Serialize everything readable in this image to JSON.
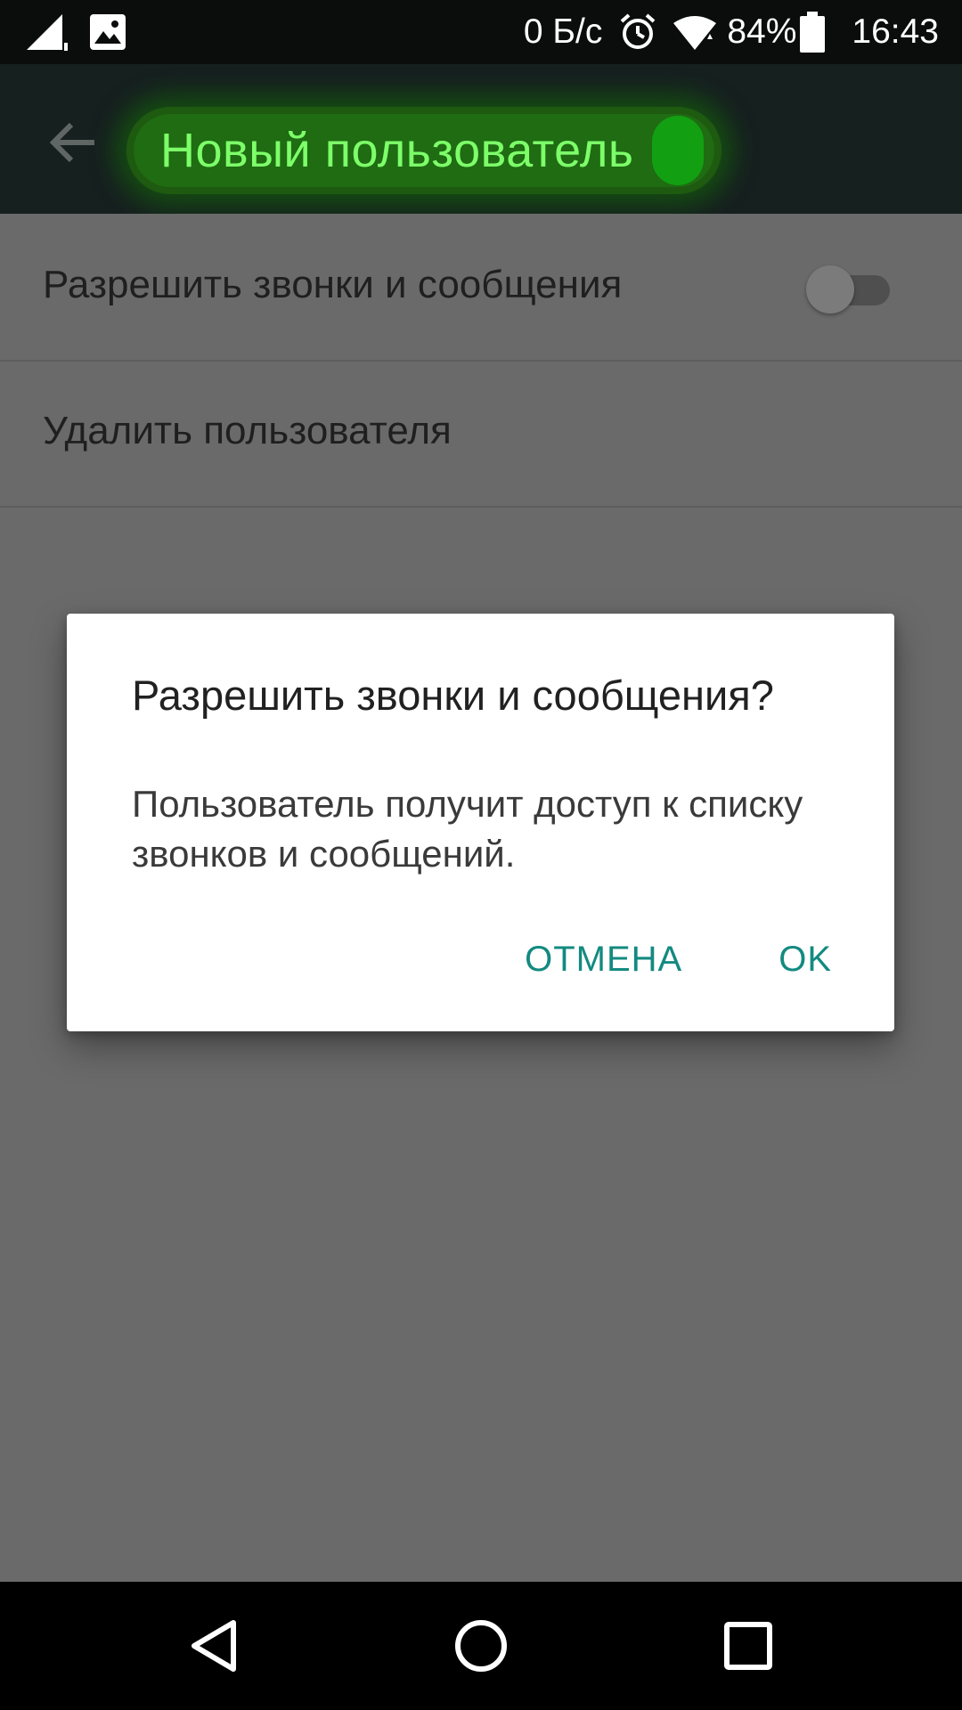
{
  "status_bar": {
    "network_speed": "0 Б/с",
    "battery_percent": "84%",
    "time": "16:43",
    "icons": [
      "signal-icon",
      "image-notification-icon",
      "alarm-icon",
      "wifi-icon",
      "battery-icon"
    ]
  },
  "app_bar": {
    "title": "Новый пользователь",
    "back_icon": "arrow-back-icon"
  },
  "settings": {
    "rows": [
      {
        "label": "Разрешить звонки и сообщения",
        "toggle_on": false
      },
      {
        "label": "Удалить пользователя"
      }
    ]
  },
  "dialog": {
    "title": "Разрешить звонки и сообщения?",
    "message": "Пользователь получит доступ к списку звонков и сообщений.",
    "cancel_label": "ОТМЕНА",
    "ok_label": "OK"
  },
  "colors": {
    "accent": "#138a80",
    "title_highlight": "#7dff6a",
    "scrim_background": "#6a6a6a"
  },
  "nav_bar": {
    "icons": [
      "back-triangle-icon",
      "home-circle-icon",
      "recents-square-icon"
    ]
  }
}
